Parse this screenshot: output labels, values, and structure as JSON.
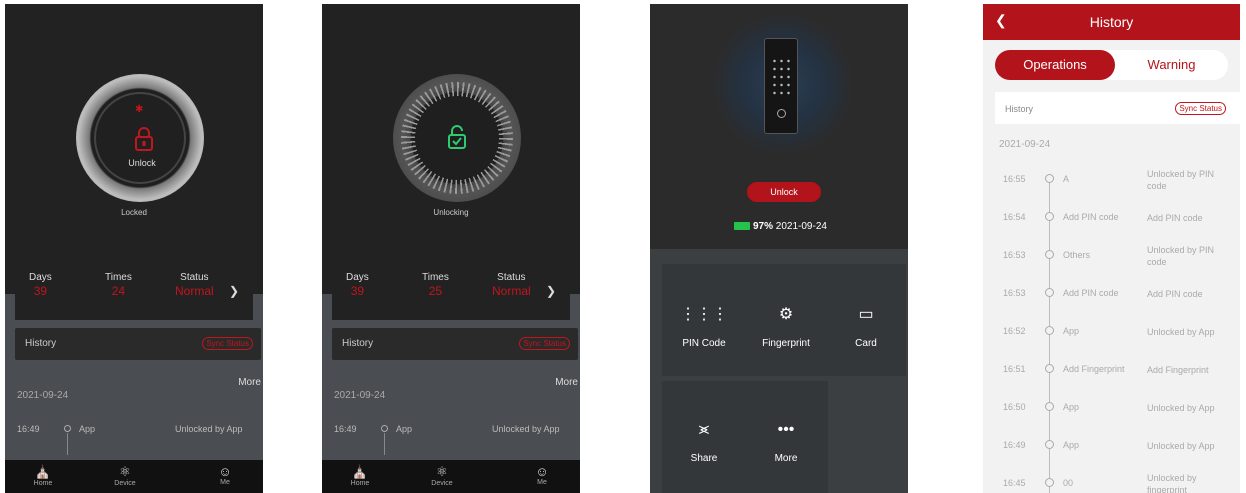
{
  "home_locked": {
    "ring_label": "Unlock",
    "state_label": "Locked",
    "stats": {
      "days_label": "Days",
      "days_value": "39",
      "times_label": "Times",
      "times_value": "24",
      "status_label": "Status",
      "status_value": "Normal"
    },
    "history_label": "History",
    "sync_label": "Sync Status",
    "more_label": "More",
    "date": "2021-09-24",
    "log": {
      "time": "16:49",
      "user": "App",
      "op": "Unlocked by App"
    },
    "tabs": [
      "Home",
      "Device",
      "Me"
    ]
  },
  "home_unlocking": {
    "state_label": "Unlocking",
    "stats": {
      "days_label": "Days",
      "days_value": "39",
      "times_label": "Times",
      "times_value": "25",
      "status_label": "Status",
      "status_value": "Normal"
    },
    "history_label": "History",
    "sync_label": "Sync Status",
    "more_label": "More",
    "date": "2021-09-24",
    "log": {
      "time": "16:49",
      "user": "App",
      "op": "Unlocked by App"
    },
    "tabs": [
      "Home",
      "Device",
      "Me"
    ]
  },
  "device": {
    "unlock_label": "Unlock",
    "battery_pct": "97%",
    "battery_date": "2021-09-24",
    "grid": [
      "PIN Code",
      "Fingerprint",
      "Card",
      "Share",
      "More"
    ]
  },
  "history": {
    "title": "History",
    "tab_operations": "Operations",
    "tab_warning": "Warning",
    "bar_label": "History",
    "sync_label": "Sync Status",
    "date": "2021-09-24",
    "rows": [
      {
        "time": "16:55",
        "user": "A",
        "op": "Unlocked by PIN code"
      },
      {
        "time": "16:54",
        "user": "Add PIN code",
        "op": "Add PIN code"
      },
      {
        "time": "16:53",
        "user": "Others",
        "op": "Unlocked by PIN code"
      },
      {
        "time": "16:53",
        "user": "Add PIN code",
        "op": "Add PIN code"
      },
      {
        "time": "16:52",
        "user": "App",
        "op": "Unlocked by App"
      },
      {
        "time": "16:51",
        "user": "Add Fingerprint",
        "op": "Add Fingerprint"
      },
      {
        "time": "16:50",
        "user": "App",
        "op": "Unlocked by App"
      },
      {
        "time": "16:49",
        "user": "App",
        "op": "Unlocked by App"
      },
      {
        "time": "16:45",
        "user": "00",
        "op": "Unlocked by fingerprint"
      }
    ]
  },
  "colors": {
    "accent": "#b3141c",
    "battery": "#27c24c",
    "unlocked": "#2ecc71"
  }
}
